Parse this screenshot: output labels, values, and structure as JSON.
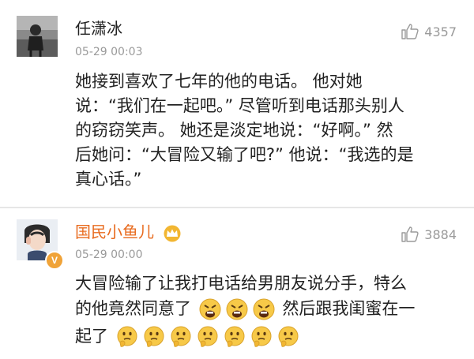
{
  "comments": [
    {
      "username": "任潇冰",
      "timestamp": "05-29 00:03",
      "likes": "4357",
      "avatar_icon": "photo-avatar",
      "lines": [
        "她接到喜欢了七年的他的电话。 他对她",
        "说：“我们在一起吧。” 尽管听到电话那头别人",
        "的窃窃笑声。 她还是淡定地说：“好啊。” 然",
        "后她问：“大冒险又输了吧?” 他说：“我选的是",
        "真心话。”"
      ]
    },
    {
      "username": "国民小鱼儿",
      "timestamp": "05-29 00:00",
      "likes": "3884",
      "avatar_icon": "photo-avatar",
      "badge": "V",
      "badge_icon": "vip-badge-icon",
      "crown_icon": "crown-icon",
      "lines": [
        "大冒险输了让我打电话给男朋友说分手，特么",
        "的他竟然同意了",
        "然后跟我闺蜜在一",
        "起了"
      ],
      "inline_emoji": [
        "angry-face-icon",
        "angry-face-icon",
        "angry-face-icon"
      ],
      "trailing_emoji": [
        "thinking-face-icon",
        "thinking-face-icon",
        "thinking-face-icon",
        "thinking-face-icon",
        "thinking-face-icon",
        "thinking-face-icon",
        "thinking-face-icon"
      ]
    }
  ],
  "colors": {
    "vip_name": "#e86b1f",
    "meta_gray": "#9a9a9a",
    "divider": "#e6e6e6",
    "crown": "#f2b632",
    "emoji": "#f7c948"
  }
}
